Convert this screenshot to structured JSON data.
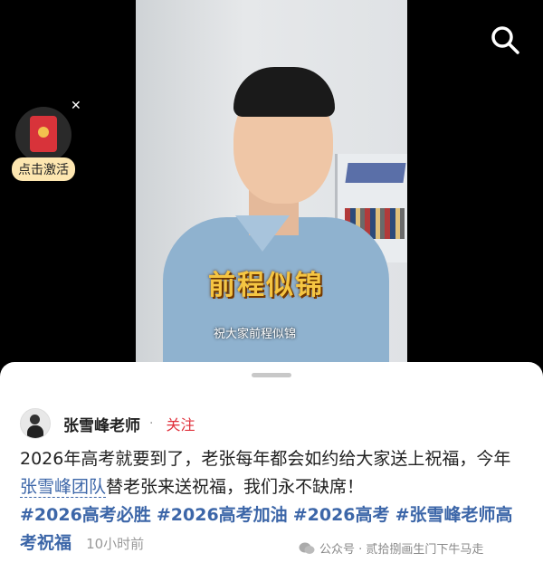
{
  "video": {
    "caption_big": "前程似锦",
    "subtitle": "祝大家前程似锦"
  },
  "promo": {
    "label": "点击激活"
  },
  "post": {
    "author_name": "张雪峰老师",
    "follow_label": "关注",
    "text_part1": "2026年高考就要到了，老张每年都会如约给大家送上祝福，今年",
    "mention": "张雪峰团队",
    "text_part2": "替老张来送祝福，我们永不缺席！",
    "hashtags": [
      "#2026高考必胜",
      "#2026高考加油",
      "#2026高考",
      "#张雪峰老师高考祝福"
    ],
    "time": "10小时前"
  },
  "watermark": {
    "text": "公众号 · 贰拾捌画生门下牛马走"
  }
}
